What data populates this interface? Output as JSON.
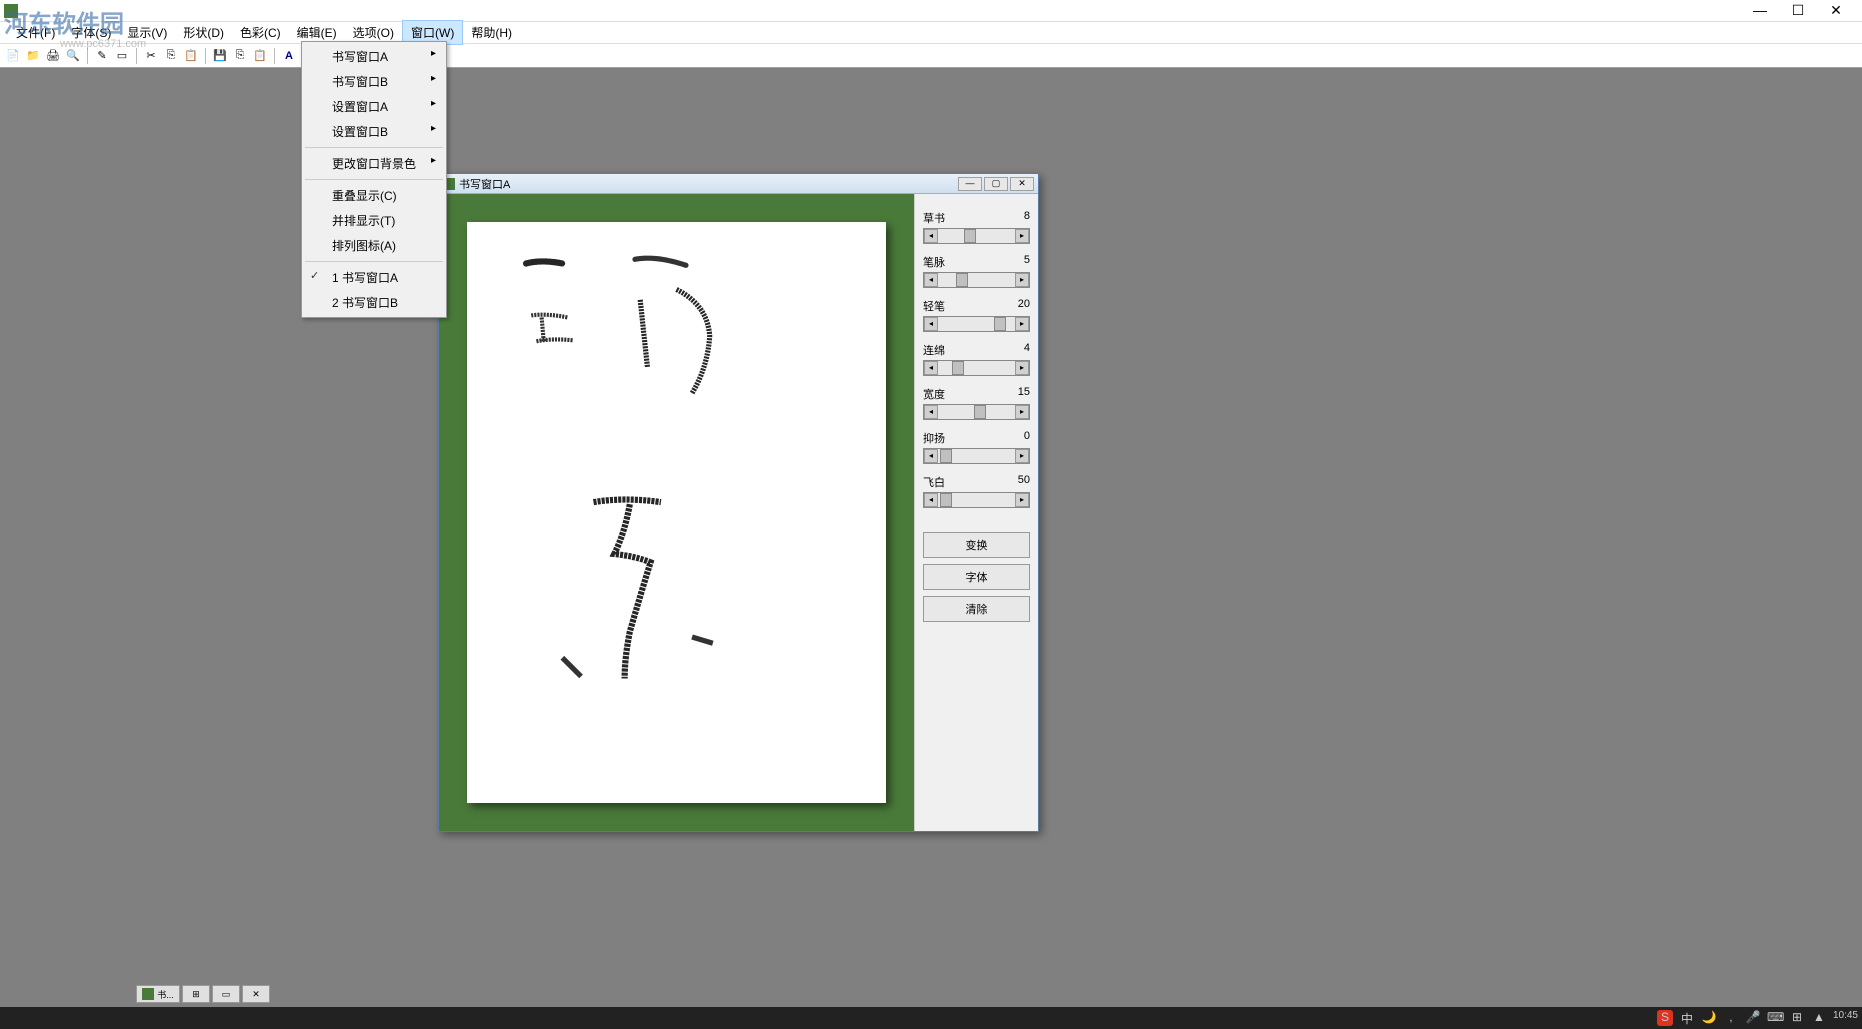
{
  "watermark": {
    "main": "河东软件园",
    "sub": "www.pc6371.com"
  },
  "titlebar": {
    "controls": {
      "min": "—",
      "max": "☐",
      "close": "✕"
    }
  },
  "menubar": {
    "items": [
      {
        "label": "文件(F)"
      },
      {
        "label": "字体(S)"
      },
      {
        "label": "显示(V)"
      },
      {
        "label": "形状(D)"
      },
      {
        "label": "色彩(C)"
      },
      {
        "label": "编辑(E)"
      },
      {
        "label": "选项(O)"
      },
      {
        "label": "窗口(W)",
        "active": true
      },
      {
        "label": "帮助(H)"
      }
    ]
  },
  "dropdown": {
    "items": [
      {
        "label": "书写窗口A",
        "sub": true
      },
      {
        "label": "书写窗口B",
        "sub": true
      },
      {
        "label": "设置窗口A",
        "sub": true
      },
      {
        "label": "设置窗口B",
        "sub": true
      },
      {
        "sep": true
      },
      {
        "label": "更改窗口背景色",
        "sub": true
      },
      {
        "sep": true
      },
      {
        "label": "重叠显示(C)"
      },
      {
        "label": "并排显示(T)"
      },
      {
        "label": "排列图标(A)"
      },
      {
        "sep": true
      },
      {
        "label": "1 书写窗口A",
        "check": true
      },
      {
        "label": "2 书写窗口B"
      }
    ]
  },
  "childWindow": {
    "title": "书写窗口A",
    "sliders": [
      {
        "label": "草书",
        "value": "8",
        "pos": 40
      },
      {
        "label": "笔脉",
        "value": "5",
        "pos": 32
      },
      {
        "label": "轻笔",
        "value": "20",
        "pos": 70
      },
      {
        "label": "连绵",
        "value": "4",
        "pos": 28
      },
      {
        "label": "宽度",
        "value": "15",
        "pos": 50
      },
      {
        "label": "抑扬",
        "value": "0",
        "pos": 16
      },
      {
        "label": "飞白",
        "value": "50",
        "pos": 16
      }
    ],
    "buttons": {
      "convert": "变换",
      "font": "字体",
      "clear": "清除"
    }
  },
  "mdi": {
    "tab_label": "书..."
  },
  "tray": {
    "items": [
      "S",
      "中",
      "🌙",
      ",",
      "🎤",
      "⌨",
      "⊞",
      "▲"
    ],
    "time": "10:45"
  }
}
